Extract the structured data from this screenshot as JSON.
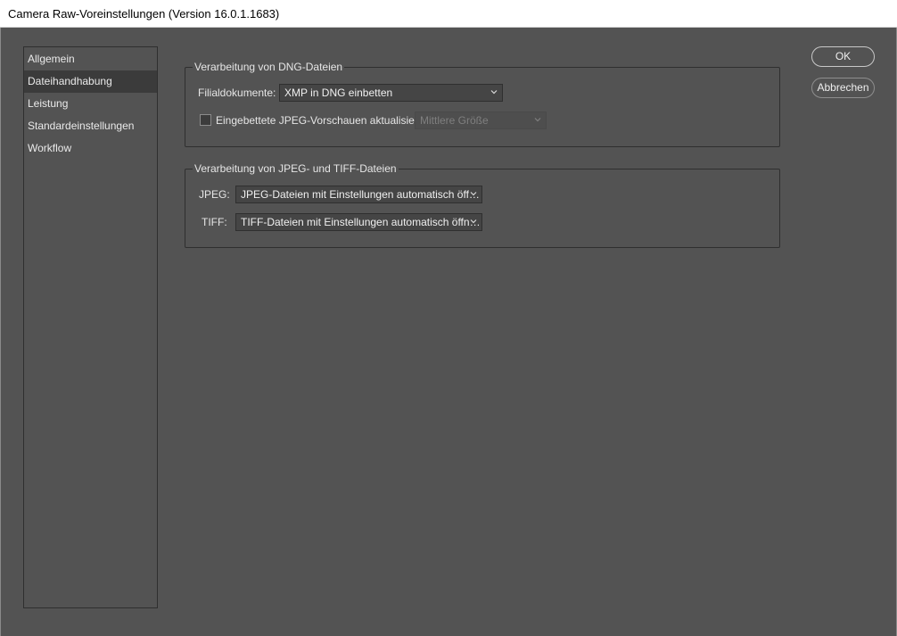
{
  "window": {
    "title": "Camera Raw-Voreinstellungen  (Version 16.0.1.1683)"
  },
  "sidebar": {
    "items": [
      {
        "label": "Allgemein",
        "selected": false
      },
      {
        "label": "Dateihandhabung",
        "selected": true
      },
      {
        "label": "Leistung",
        "selected": false
      },
      {
        "label": "Standardeinstellungen",
        "selected": false
      },
      {
        "label": "Workflow",
        "selected": false
      }
    ]
  },
  "dng_group": {
    "title": "Verarbeitung von DNG-Dateien",
    "sidecar_label": "Filialdokumente:",
    "sidecar_value": "XMP in DNG einbetten",
    "update_previews_label": "Eingebettete JPEG-Vorschauen aktualisieren:",
    "update_previews_checked": false,
    "preview_size_value": "Mittlere Größe"
  },
  "jpeg_tiff_group": {
    "title": "Verarbeitung von JPEG- und TIFF-Dateien",
    "jpeg_label": "JPEG:",
    "jpeg_value": "JPEG-Dateien mit Einstellungen automatisch öff…",
    "tiff_label": "TIFF:",
    "tiff_value": "TIFF-Dateien mit Einstellungen automatisch öffn…"
  },
  "buttons": {
    "ok": "OK",
    "cancel": "Abbrechen"
  },
  "icons": {
    "dropdown": "chevron-down-icon"
  },
  "colors": {
    "background": "#535353",
    "selected_item": "#3b3b3b",
    "titlebar": "#ffffff"
  }
}
